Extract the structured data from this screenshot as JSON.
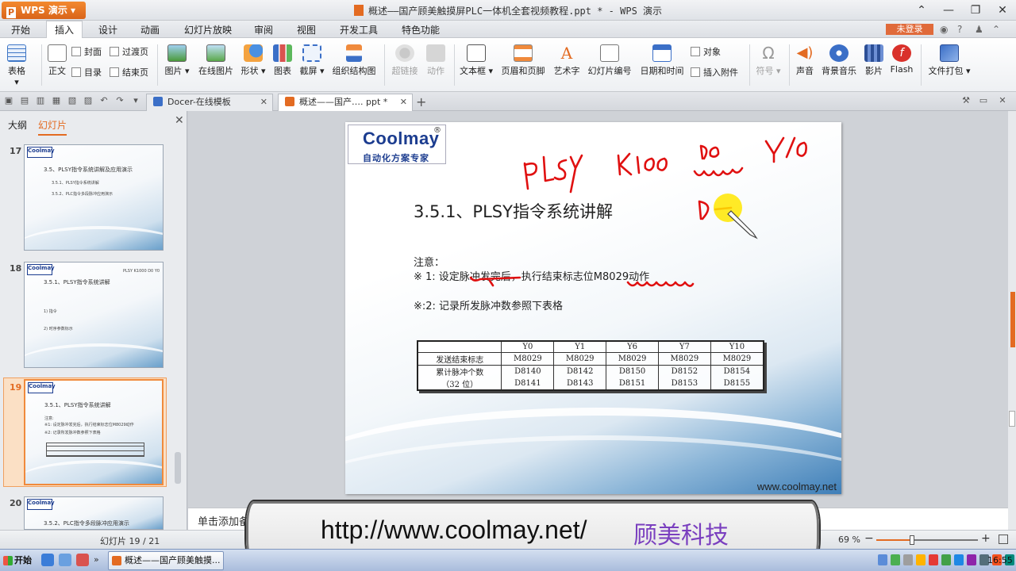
{
  "app": {
    "name": "WPS 演示",
    "title": "概述——国产顾美触摸屏PLC一体机全套视频教程.ppt * - WPS 演示"
  },
  "menu": {
    "items": [
      "开始",
      "插入",
      "设计",
      "动画",
      "幻灯片放映",
      "审阅",
      "视图",
      "开发工具",
      "特色功能"
    ],
    "active": "插入",
    "login": "未登录"
  },
  "ribbon": {
    "table": "表格",
    "cover": "封面",
    "transition": "过渡页",
    "body": "正文",
    "toc": "目录",
    "end": "结束页",
    "picture": "图片",
    "online_picture": "在线图片",
    "shapes": "形状",
    "chart": "图表",
    "screenshot": "截屏",
    "org_chart": "组织结构图",
    "hyperlink": "超链接",
    "action": "动作",
    "textbox": "文本框",
    "header_footer": "页眉和页脚",
    "wordart": "艺术字",
    "slide_number": "幻灯片编号",
    "datetime": "日期和时间",
    "object": "对象",
    "attachment": "插入附件",
    "symbol": "符号",
    "sound": "声音",
    "bg_music": "背景音乐",
    "movie": "影片",
    "flash": "Flash",
    "package": "文件打包"
  },
  "tabs": {
    "template_tab": "Docer-在线模板",
    "doc_tab": "概述——国产…. ppt *"
  },
  "left_panel": {
    "tab_outline": "大纲",
    "tab_slides": "幻灯片",
    "slides": [
      {
        "num": "17",
        "title": "3.5、PLSY指令系统讲解及应用演示",
        "lines": [
          "3.5.1、PLSY指令系统讲解",
          "3.5.2、PLC指令多段脉冲应用演示"
        ]
      },
      {
        "num": "18",
        "title": "3.5.1、PLSY指令系统讲解",
        "lines": [
          "PLSY K1000 D0 Y0",
          "1) 指令",
          "2) 时序参数标示"
        ]
      },
      {
        "num": "19",
        "title": "3.5.1、PLSY指令系统讲解",
        "lines": [
          "注意:",
          "※1: 设定脉冲发完后，执行结束标志位M8029动作",
          "※2: 记录所发脉冲数参照下表格"
        ]
      },
      {
        "num": "20",
        "title": "3.5.2、PLC指令多段脉冲应用演示",
        "lines": []
      }
    ],
    "selected": "19"
  },
  "slide": {
    "logo_brand": "Coolmay",
    "logo_reg": "®",
    "logo_tagline": "自动化方案专家",
    "title": "3.5.1、PLSY指令系统讲解",
    "note_head": "注意：",
    "note1": "※ 1:  设定脉冲发完后，执行结束标志位M8029动作",
    "note2": "※:2:    记录所发脉冲数参照下表格",
    "table": {
      "headers": [
        "",
        "Y0",
        "Y1",
        "Y6",
        "Y7",
        "Y10"
      ],
      "rows": [
        [
          "发送结束标志",
          "M8029",
          "M8029",
          "M8029",
          "M8029",
          "M8029"
        ],
        [
          "累计脉冲个数",
          "D8140",
          "D8142",
          "D8150",
          "D8152",
          "D8154"
        ],
        [
          "（32 位）",
          "D8141",
          "D8143",
          "D8151",
          "D8153",
          "D8155"
        ]
      ]
    },
    "footer_url": "www.coolmay.net",
    "handwriting": [
      "PLSY",
      "K100",
      "D0",
      "Y0"
    ]
  },
  "notes_placeholder": "单击添加备注",
  "status": {
    "slide_counter": "幻灯片 19 / 21",
    "zoom": "69 %",
    "zoom_fraction": 0.35
  },
  "banner": {
    "url": "http://www.coolmay.net/",
    "brand": "顾美科技"
  },
  "taskbar": {
    "start": "开始",
    "task": "概述——国产顾美触摸...",
    "clock": "16:55"
  }
}
